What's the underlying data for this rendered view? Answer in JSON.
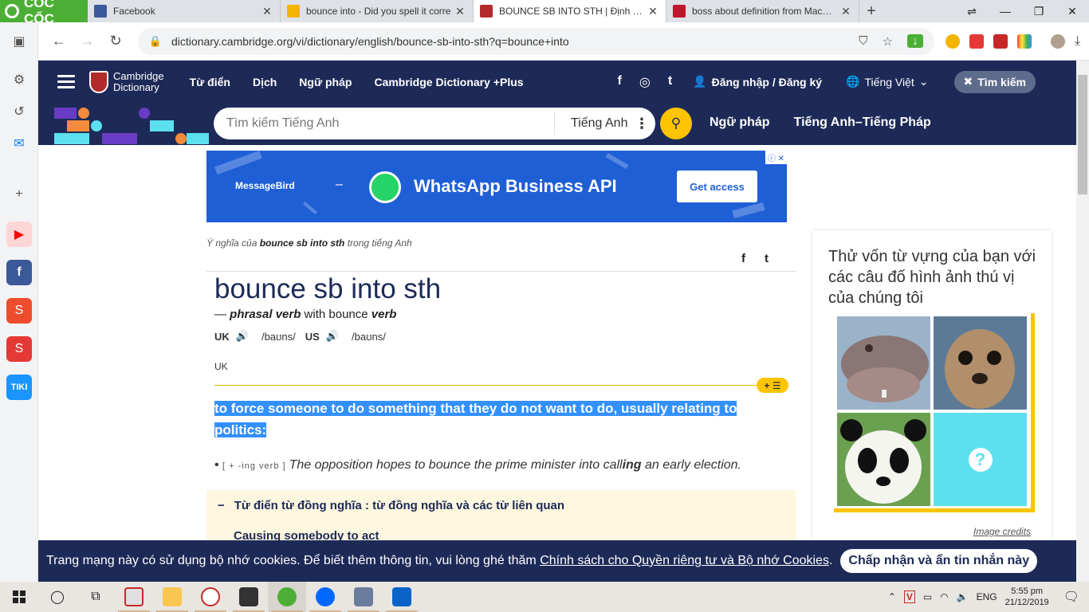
{
  "browser": {
    "logo_text": "CỐC CỐC",
    "tabs": [
      {
        "title": "Facebook",
        "fav_color": "#3b5998",
        "active": false
      },
      {
        "title": "bounce into - Did you spell it corre",
        "fav_color": "#f4b400",
        "active": false
      },
      {
        "title": "BOUNCE SB INTO STH | Định nghĩa",
        "fav_color": "#b32a2a",
        "active": true
      },
      {
        "title": "boss about definition from Macmilla",
        "fav_color": "#c0152c",
        "active": false
      }
    ],
    "new_tab": "+",
    "url": "dictionary.cambridge.org/vi/dictionary/english/bounce-sb-into-sth?q=bounce+into"
  },
  "header": {
    "logo_line1": "Cambridge",
    "logo_line2": "Dictionary",
    "nav": [
      "Từ điển",
      "Dịch",
      "Ngữ pháp",
      "Cambridge Dictionary +Plus"
    ],
    "social": [
      "f",
      "◎",
      "t"
    ],
    "login": "Đăng nhập / Đăng ký",
    "language": "Tiếng Việt",
    "search_button": "Tìm kiếm"
  },
  "search": {
    "placeholder": "Tìm kiếm Tiếng Anh",
    "language": "Tiếng Anh",
    "quick_links": [
      "Ngữ pháp",
      "Tiếng Anh–Tiếng Pháp"
    ]
  },
  "ad": {
    "brand": "MessageBird",
    "dash": "–",
    "title": "WhatsApp Business API",
    "cta": "Get access",
    "close": "ⓘ ✕"
  },
  "entry": {
    "caption_prefix": "Ý nghĩa của ",
    "caption_word": "bounce sb into sth",
    "caption_suffix": " trong tiếng Anh",
    "headword": "bounce sb into sth",
    "pos_dash": "— ",
    "pos": "phrasal verb",
    "with_text": " with bounce ",
    "with_pos": "verb",
    "uk_label": "UK",
    "uk_ipa": "/baʊns/",
    "us_label": "US",
    "us_ipa": "/baʊns/",
    "region": "UK",
    "list_button": "+ ☰",
    "definition": "to force someone to do something that they do not want to do, usually relating to politics:",
    "example_bullet": "• ",
    "example_grammar": "[ + -ing verb ]",
    "example_pre": "The opposition hopes to bounce the prime minister into call",
    "example_bold": "ing",
    "example_post": " an early election.",
    "thesaurus_minus": "−",
    "thesaurus_title": "Từ điển từ đồng nghĩa : từ đồng nghĩa và các từ liên quan",
    "thesaurus_sub": "Causing somebody to act"
  },
  "quiz": {
    "title": "Thử vốn từ vựng của bạn với các câu đố hình ảnh thú vị của chúng tôi",
    "question_mark": "?",
    "credits": "Image credits"
  },
  "cookie": {
    "text": "Trang mạng này có sử dụng bộ nhớ cookies. Để biết thêm thông tin, vui lòng ghé thăm ",
    "link": "Chính sách cho Quyền riêng tư và Bộ nhớ Cookies",
    "period": ".",
    "button": "Chấp nhận và ẩn tin nhắn này"
  },
  "taskbar": {
    "lang": "ENG",
    "time": "5:55 pm",
    "date": "21/12/2019"
  }
}
